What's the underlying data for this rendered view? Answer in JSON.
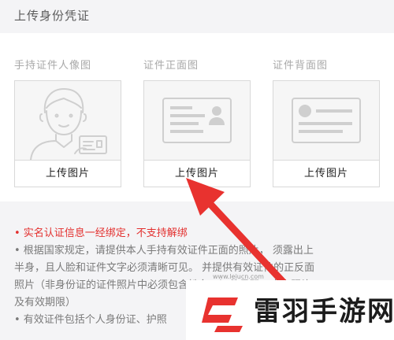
{
  "header": {
    "title": "上传身份凭证"
  },
  "upload": {
    "items": [
      {
        "label": "手持证件人像图",
        "button": "上传图片"
      },
      {
        "label": "证件正面图",
        "button": "上传图片"
      },
      {
        "label": "证件背面图",
        "button": "上传图片"
      }
    ]
  },
  "notes": {
    "warning": "• 实名认证信息一经绑定，不支持解绑",
    "lines": [
      "• 根据国家规定，请提供本人手持有效证件正面的照片， 须露出上",
      "半身，且人脸和证件文字必须清晰可见。 并提供有效证件的正反面",
      "照片（非身份证的证件照片中必须包含姓名、证件号码、本人照片",
      "及有效期限）",
      "• 有效证件包括个人身份证、护照"
    ]
  },
  "watermark": {
    "brand": "雷羽手游网",
    "url": "www.leiucn.com"
  },
  "colors": {
    "accent_red": "#e3302f",
    "arrow_red": "#e8322f",
    "border": "#d9d9d9"
  }
}
